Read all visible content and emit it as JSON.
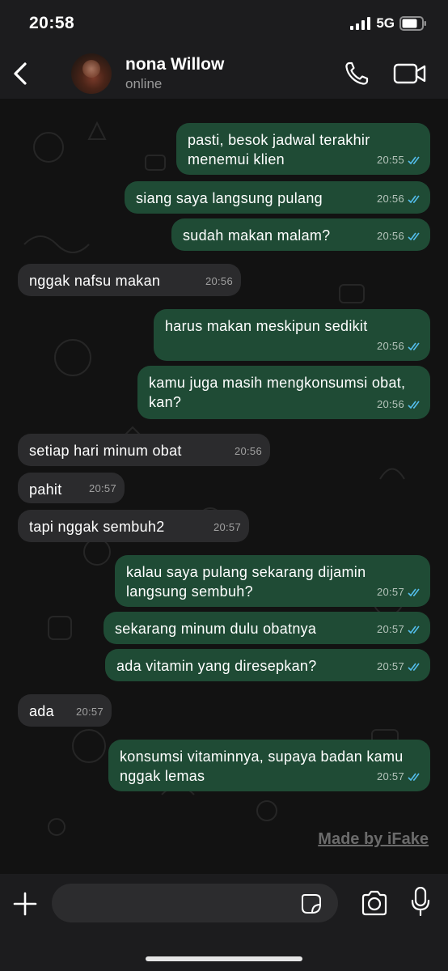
{
  "status_bar": {
    "time": "20:58",
    "network": "5G"
  },
  "header": {
    "contact_name": "nona Willow",
    "contact_status": "online"
  },
  "messages": [
    {
      "direction": "out",
      "text": "pasti, besok jadwal terakhir menemui klien",
      "time": "20:55",
      "read": true
    },
    {
      "direction": "out",
      "text": "siang saya langsung pulang",
      "time": "20:56",
      "read": true
    },
    {
      "direction": "out",
      "text": "sudah makan malam?",
      "time": "20:56",
      "read": true
    },
    {
      "direction": "in",
      "text": "nggak nafsu makan",
      "time": "20:56"
    },
    {
      "direction": "out",
      "text": "harus makan meskipun sedikit",
      "time": "20:56",
      "read": true
    },
    {
      "direction": "out",
      "text": "kamu juga masih mengkonsumsi obat, kan?",
      "time": "20:56",
      "read": true
    },
    {
      "direction": "in",
      "text": "setiap hari minum obat",
      "time": "20:56"
    },
    {
      "direction": "in",
      "text": "pahit",
      "time": "20:57"
    },
    {
      "direction": "in",
      "text": "tapi nggak sembuh2",
      "time": "20:57"
    },
    {
      "direction": "out",
      "text": "kalau saya pulang sekarang dijamin langsung sembuh?",
      "time": "20:57",
      "read": true
    },
    {
      "direction": "out",
      "text": "sekarang minum dulu obatnya",
      "time": "20:57",
      "read": true
    },
    {
      "direction": "out",
      "text": "ada vitamin yang diresepkan?",
      "time": "20:57",
      "read": true
    },
    {
      "direction": "in",
      "text": "ada",
      "time": "20:57"
    },
    {
      "direction": "out",
      "text": "konsumsi vitaminnya, supaya badan kamu nggak lemas",
      "time": "20:57",
      "read": true
    }
  ],
  "watermark": "Made by iFake",
  "input": {
    "value": "",
    "placeholder": ""
  },
  "colors": {
    "outgoing_bubble": "#1f4b35",
    "incoming_bubble": "#2b2b2d",
    "read_tick": "#53bdeb",
    "background": "#121212"
  },
  "icons": [
    "back-chevron-icon",
    "phone-icon",
    "video-camera-icon",
    "plus-icon",
    "sticker-icon",
    "camera-icon",
    "microphone-icon",
    "double-check-icon"
  ]
}
